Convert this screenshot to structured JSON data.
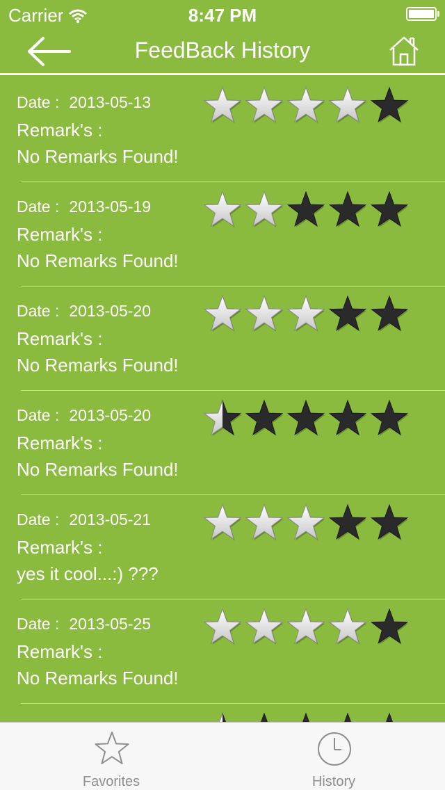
{
  "status_bar": {
    "carrier": "Carrier",
    "time": "8:47 PM"
  },
  "nav": {
    "title": "FeedBack History",
    "back_icon": "back-arrow-icon",
    "home_icon": "home-icon"
  },
  "colors": {
    "background": "#8abb3e",
    "star_filled": "#f2f2f2",
    "star_empty": "#2a2a2a",
    "tab_bar": "#f7f7f7"
  },
  "feedback": [
    {
      "date_label": "Date :",
      "date": "2013-05-13",
      "remark_label": "Remark's :",
      "remark": "No Remarks Found!",
      "rating": 4
    },
    {
      "date_label": "Date :",
      "date": "2013-05-19",
      "remark_label": "Remark's :",
      "remark": "No Remarks Found!",
      "rating": 2
    },
    {
      "date_label": "Date :",
      "date": "2013-05-20",
      "remark_label": "Remark's :",
      "remark": "No Remarks Found!",
      "rating": 3
    },
    {
      "date_label": "Date :",
      "date": "2013-05-20",
      "remark_label": "Remark's :",
      "remark": "No Remarks Found!",
      "rating": 0.5
    },
    {
      "date_label": "Date :",
      "date": "2013-05-21",
      "remark_label": "Remark's :",
      "remark": "yes it cool...:) ???",
      "rating": 3
    },
    {
      "date_label": "Date :",
      "date": "2013-05-25",
      "remark_label": "Remark's :",
      "remark": "No Remarks Found!",
      "rating": 4
    },
    {
      "date_label": "",
      "date": "",
      "remark_label": "",
      "remark": "",
      "rating": 0.5
    }
  ],
  "tabs": [
    {
      "label": "Favorites",
      "icon": "star-outline-icon"
    },
    {
      "label": "History",
      "icon": "clock-icon"
    }
  ]
}
